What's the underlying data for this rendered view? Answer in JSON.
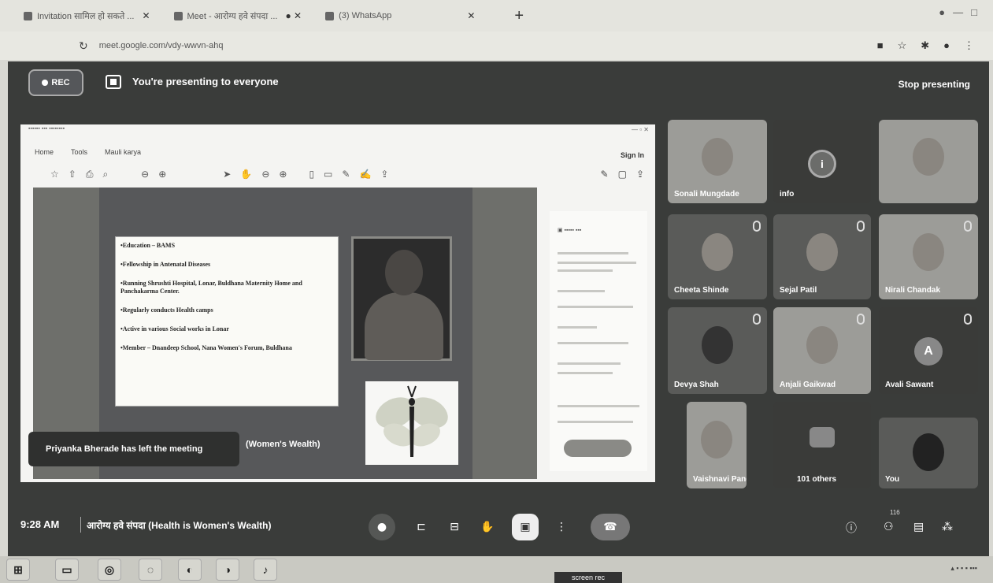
{
  "browser": {
    "tabs": [
      {
        "label": "Invitation सामिल हो सकते ..."
      },
      {
        "label": "Meet - आरोग्य हवे संपदा ..."
      },
      {
        "label": "(3) WhatsApp"
      }
    ],
    "url": "meet.google.com/vdy-wwvn-ahq"
  },
  "meet": {
    "rec_label": "REC",
    "presenting_text": "You're presenting to everyone",
    "stop_presenting": "Stop presenting",
    "toast": "Priyanka Bherade has left the meeting",
    "clock": "9:28 AM",
    "meeting_name": "आरोग्य हवे संपदा (Health is Women's Wealth)",
    "people_count": "116"
  },
  "shared": {
    "viewer_menu": [
      "Home",
      "Tools",
      "Mauli karya"
    ],
    "sign_in": "Sign In",
    "slide_lines": [
      "•Education – BAMS",
      "•Fellowship in Antenatal Diseases",
      "•Running Shrushti Hospital, Lonar, Buldhana Maternity Home and Panchakarma Center.",
      "•Regularly conducts Health camps",
      "•Active in various Social works in Lonar",
      "•Member – Dnandeep School, Nana Women's Forum, Buldhana"
    ],
    "slide_footer": "(Women's Wealth)"
  },
  "participants": [
    {
      "name": "Sonali Mungdade"
    },
    {
      "name": "info"
    },
    {
      "name": ""
    },
    {
      "name": "Cheeta Shinde"
    },
    {
      "name": "Sejal Patil"
    },
    {
      "name": "Nirali Chandak"
    },
    {
      "name": "Devya Shah"
    },
    {
      "name": "Anjali Gaikwad"
    },
    {
      "name": "Avali Sawant",
      "initial": "A"
    },
    {
      "name": "Vaishnavi Pandhe"
    },
    {
      "name": "101 others"
    },
    {
      "name": "You"
    }
  ],
  "taskbar": {
    "screen_rec": "screen rec"
  },
  "colors": {
    "meet_bg": "#3a3c3a",
    "shared_bg": "#f4f4f2",
    "toast_bg": "#2f302f"
  }
}
